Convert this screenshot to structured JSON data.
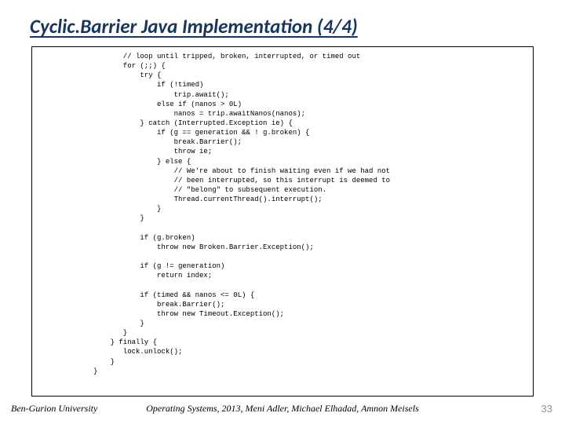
{
  "title": "Cyclic.Barrier Java Implementation (4/4)",
  "code": "       // loop until tripped, broken, interrupted, or timed out\n       for (;;) {\n           try {\n               if (!timed)\n                   trip.await();\n               else if (nanos > 0L)\n                   nanos = trip.awaitNanos(nanos);\n           } catch (Interrupted.Exception ie) {\n               if (g == generation && ! g.broken) {\n                   break.Barrier();\n                   throw ie;\n               } else {\n                   // We're about to finish waiting even if we had not\n                   // been interrupted, so this interrupt is deemed to\n                   // \"belong\" to subsequent execution.\n                   Thread.currentThread().interrupt();\n               }\n           }\n\n           if (g.broken)\n               throw new Broken.Barrier.Exception();\n\n           if (g != generation)\n               return index;\n\n           if (timed && nanos <= 0L) {\n               break.Barrier();\n               throw new Timeout.Exception();\n           }\n       }\n    } finally {\n       lock.unlock();\n    }\n}",
  "footer": {
    "left": "Ben-Gurion University",
    "center": "Operating Systems, 2013, Meni Adler, Michael Elhadad, Amnon Meisels",
    "page": "33"
  }
}
